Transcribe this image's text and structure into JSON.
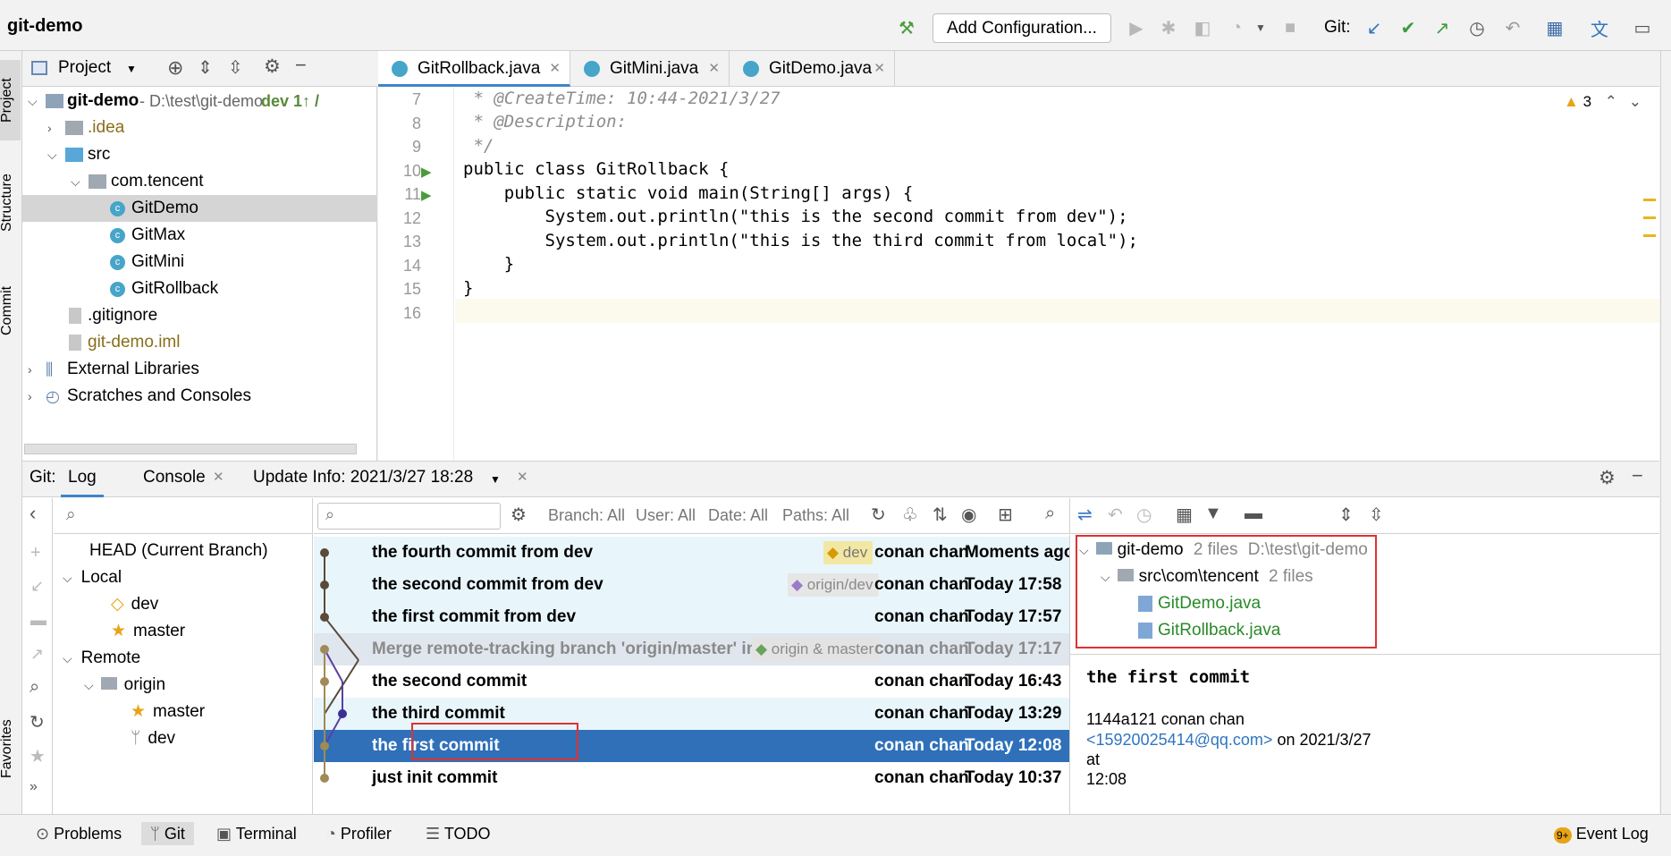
{
  "window": {
    "title": "git-demo"
  },
  "toolbar": {
    "add_configuration": "Add Configuration...",
    "git_label": "Git:"
  },
  "left_strip": {
    "project": "Project",
    "structure": "Structure",
    "commit": "Commit",
    "favorites": "Favorites"
  },
  "project_panel": {
    "header": "Project",
    "tree": [
      {
        "label": "git-demo",
        "path": "- D:\\test\\git-demo",
        "branch": "dev 1↑ /"
      },
      {
        "label": ".idea"
      },
      {
        "label": "src"
      },
      {
        "label": "com.tencent"
      },
      {
        "label": "GitDemo"
      },
      {
        "label": "GitMax"
      },
      {
        "label": "GitMini"
      },
      {
        "label": "GitRollback"
      },
      {
        "label": ".gitignore"
      },
      {
        "label": "git-demo.iml"
      },
      {
        "label": "External Libraries"
      },
      {
        "label": "Scratches and Consoles"
      }
    ]
  },
  "editor": {
    "tabs": [
      {
        "label": "GitRollback.java",
        "active": true
      },
      {
        "label": "GitMini.java"
      },
      {
        "label": "GitDemo.java"
      }
    ],
    "warnings": "3",
    "lines": [
      {
        "num": "7",
        "text": " * @CreateTime: 10:44-2021/3/27"
      },
      {
        "num": "8",
        "text": " * @Description:"
      },
      {
        "num": "9",
        "text": " */"
      },
      {
        "num": "10",
        "text": "public class GitRollback {"
      },
      {
        "num": "11",
        "text": "    public static void main(String[] args) {"
      },
      {
        "num": "12",
        "text": "        System.out.println(\"this is the second commit from dev\");"
      },
      {
        "num": "13",
        "text": "        System.out.println(\"this is the third commit from local\");"
      },
      {
        "num": "14",
        "text": "    }"
      },
      {
        "num": "15",
        "text": "}"
      },
      {
        "num": "16",
        "text": ""
      }
    ]
  },
  "git_panel": {
    "label": "Git:",
    "tabs": [
      {
        "label": "Log"
      },
      {
        "label": "Console"
      },
      {
        "label": "Update Info: 2021/3/27 18:28"
      }
    ],
    "branches": {
      "head": "HEAD (Current Branch)",
      "local": "Local",
      "local_dev": "dev",
      "local_master": "master",
      "remote": "Remote",
      "origin": "origin",
      "origin_master": "master",
      "origin_dev": "dev"
    },
    "filters": {
      "branch": "Branch: All",
      "user": "User: All",
      "date": "Date: All",
      "paths": "Paths: All"
    },
    "commits": [
      {
        "message": "the fourth  commit from dev",
        "tag": "dev",
        "author": "conan chan",
        "date": "Moments ago"
      },
      {
        "message": "the second  commit from dev",
        "tag": "origin/dev",
        "author": "conan chan",
        "date": "Today 17:58"
      },
      {
        "message": "the first  commit from dev",
        "tag": "",
        "author": "conan chan",
        "date": "Today 17:57"
      },
      {
        "message": "Merge remote-tracking branch 'origin/master' into mast",
        "tag": "origin & master",
        "author": "conan chan",
        "date": "Today 17:17"
      },
      {
        "message": "the second commit",
        "tag": "",
        "author": "conan chan",
        "date": "Today 16:43"
      },
      {
        "message": "the third commit",
        "tag": "",
        "author": "conan chan",
        "date": "Today 13:29"
      },
      {
        "message": "the first commit",
        "tag": "",
        "author": "conan chan",
        "date": "Today 12:08"
      },
      {
        "message": "just init commit",
        "tag": "",
        "author": "conan chan",
        "date": "Today 10:37"
      }
    ],
    "selected_commit": 6,
    "details": {
      "root": "git-demo",
      "root_count": "2 files",
      "root_path": "D:\\test\\git-demo",
      "dir": "src\\com\\tencent",
      "dir_count": "2 files",
      "files": [
        "GitDemo.java",
        "GitRollback.java"
      ],
      "commit_title": "the first commit",
      "hash_author": "1144a121 conan chan",
      "email": "<15920025414@qq.com>",
      "date_prefix": " on 2021/3/27 at",
      "time": "12:08"
    }
  },
  "statusbar": {
    "problems": "Problems",
    "git": "Git",
    "terminal": "Terminal",
    "profiler": "Profiler",
    "todo": "TODO",
    "event_log": "Event Log",
    "event_badge": "9+"
  },
  "colors": {
    "accent": "#2f75c0",
    "selected_row": "#2f70b9",
    "highlight_row": "#e8f6fc",
    "red_box": "#e03030"
  }
}
